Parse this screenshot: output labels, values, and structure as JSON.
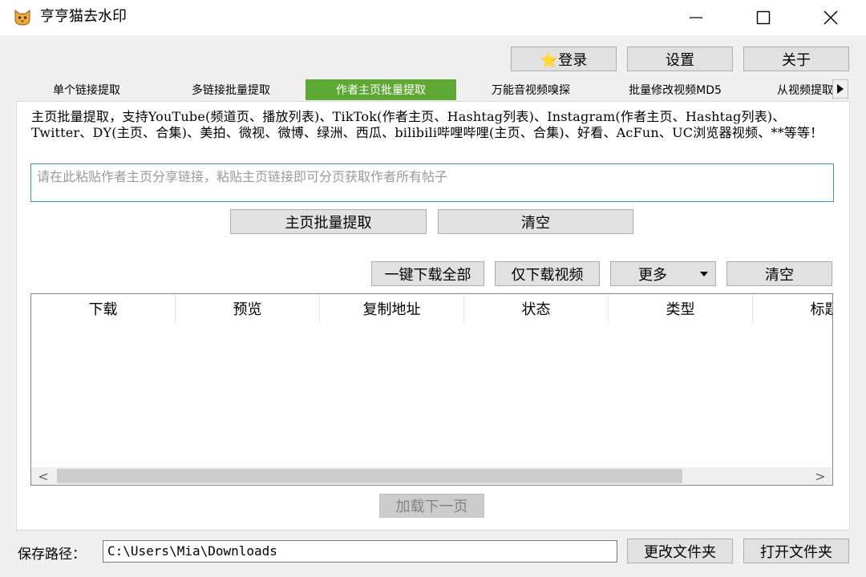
{
  "window": {
    "title": "亨亨猫去水印",
    "icon": "cat-face-icon"
  },
  "toolbar": {
    "login_label": "⭐登录",
    "settings_label": "设置",
    "about_label": "关于"
  },
  "tabs": [
    {
      "label": "单个链接提取",
      "active": false
    },
    {
      "label": "多链接批量提取",
      "active": false
    },
    {
      "label": "作者主页批量提取",
      "active": true
    },
    {
      "label": "万能音视频嗅探",
      "active": false
    },
    {
      "label": "批量修改视频MD5",
      "active": false
    },
    {
      "label": "从视频提取音",
      "active": false
    }
  ],
  "main": {
    "description": "主页批量提取，支持YouTube(频道页、播放列表)、TikTok(作者主页、Hashtag列表)、Instagram(作者主页、Hashtag列表)、Twitter、DY(主页、合集)、美拍、微视、微博、绿洲、西瓜、bilibili哔哩哔哩(主页、合集)、好看、AcFun、UC浏览器视频、**等等！",
    "url_placeholder": "请在此粘贴作者主页分享链接，粘贴主页链接即可分页获取作者所有帖子",
    "extract_button": "主页批量提取",
    "clear_button": "清空",
    "download_all_button": "一键下载全部",
    "download_video_button": "仅下载视频",
    "more_button": "更多",
    "clear_list_button": "清空",
    "columns": [
      "下载",
      "预览",
      "复制地址",
      "状态",
      "类型",
      "标题"
    ],
    "load_next_button": "加载下一页"
  },
  "footer": {
    "save_path_label": "保存路径：",
    "save_path_value": "C:\\Users\\Mia\\Downloads",
    "change_folder_button": "更改文件夹",
    "open_folder_button": "打开文件夹"
  },
  "colors": {
    "active_tab": "#5fa834",
    "input_focus_border": "#3d8fd6"
  }
}
